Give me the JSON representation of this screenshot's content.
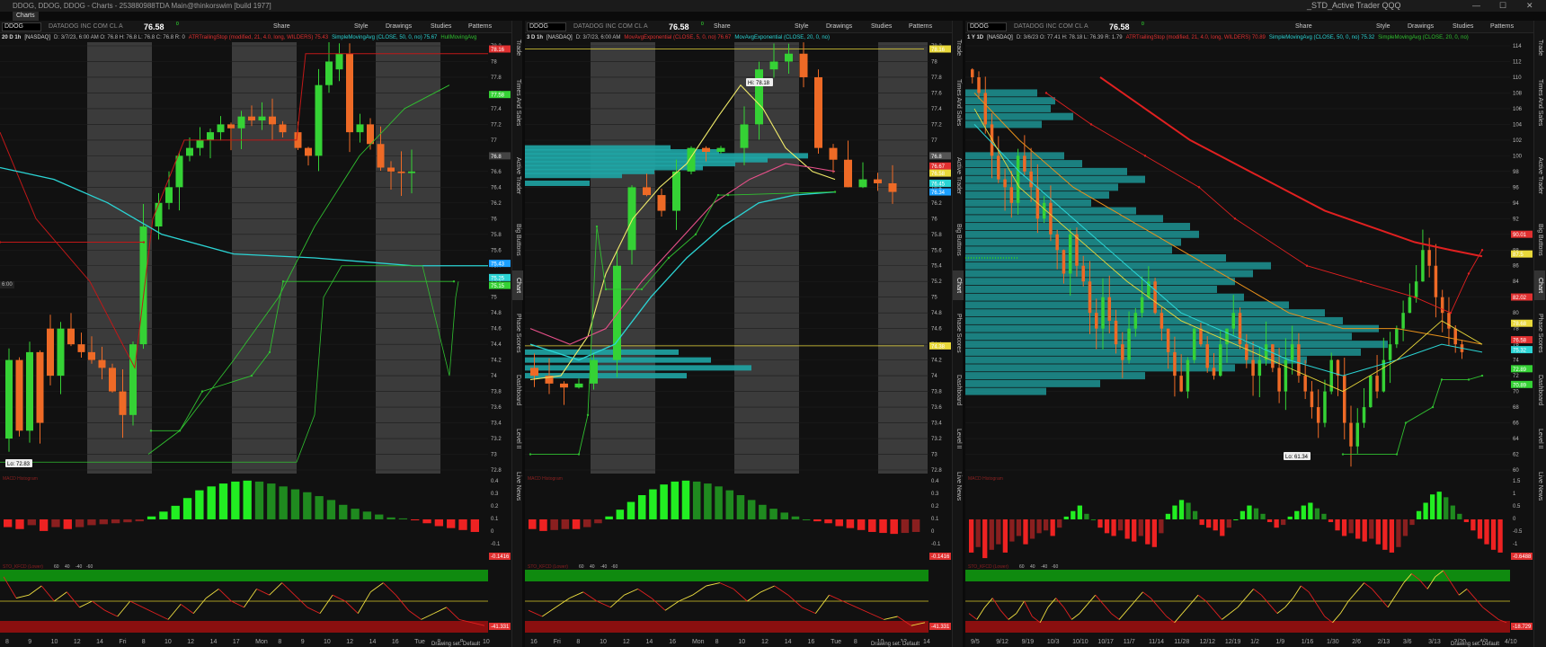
{
  "window": {
    "title": "DDOG, DDOG, DDOG - Charts - 253880988TDA Main@thinkorswim [build 1977]",
    "tab": "Charts",
    "right_title": "_STD_Active Trader QQQ"
  },
  "chart_data": [
    {
      "type": "candlestick",
      "symbol": "DDOG",
      "aggregation": "20 D 1h",
      "exchange": "[NASDAQ]",
      "price": "76.58",
      "ohlc": "D: 3/7/23, 6:00 AM   O: 76.8   H: 76.8   L: 76.8   C: 76.8   R: 0",
      "studies": [
        "ATRTrailingStop (modified, 21, 4.0, long, WILDERS)  75.43",
        "SimpleMovingAvg (CLOSE, 50, 0, no)  75.67",
        "HullMovingAvg"
      ],
      "ylim": [
        72.8,
        78.2
      ],
      "y_ticks": [
        "78.2",
        "78",
        "77.8",
        "77.6",
        "77.4",
        "77.2",
        "77",
        "76.8",
        "76.6",
        "76.4",
        "76.2",
        "76",
        "75.8",
        "75.6",
        "75.4",
        "75.2",
        "75",
        "74.8",
        "74.6",
        "74.4",
        "74.2",
        "74",
        "73.8",
        "73.6",
        "73.4",
        "73.2",
        "73",
        "72.8"
      ],
      "x_labels": [
        "8",
        "9",
        "10",
        "12",
        "14",
        "Fri",
        "8",
        "10",
        "12",
        "14",
        "17",
        "Mon",
        "8",
        "9",
        "10",
        "12",
        "14",
        "16",
        "Tue",
        "8",
        "9",
        "10"
      ],
      "price_tags": [
        "78.16",
        "77.58",
        "76.8",
        "75.43",
        "75.25",
        "75.15"
      ],
      "low_label": "Lo: 72.83",
      "time_flag": "6:00",
      "osc": {
        "name": "MACD Histogram",
        "values": [
          -0.08,
          -0.1,
          -0.06,
          -0.12,
          -0.08,
          -0.1,
          -0.08,
          -0.06,
          -0.05,
          -0.04,
          -0.03,
          -0.02,
          0.03,
          0.08,
          0.14,
          0.22,
          0.3,
          0.34,
          0.37,
          0.39,
          0.4,
          0.39,
          0.37,
          0.34,
          0.31,
          0.28,
          0.24,
          0.2,
          0.15,
          0.11,
          0.08,
          0.05,
          0.02,
          0.01,
          -0.01,
          -0.04,
          -0.07,
          -0.09,
          -0.11,
          -0.13
        ],
        "ticks": [
          "0.4",
          "0.3",
          "0.2",
          "0.1",
          "0",
          "-0.1",
          "-0.1416"
        ]
      },
      "stoch": {
        "name": "STO_KFCD (Lower)",
        "levels": [
          "60",
          "40",
          "-40",
          "-60",
          "-41.331"
        ],
        "values": [
          40,
          5,
          10,
          25,
          0,
          15,
          -10,
          0,
          -15,
          -25,
          0,
          -10,
          -20,
          -30,
          -5,
          -20,
          5,
          20,
          0,
          -10,
          20,
          10,
          30,
          10,
          -10,
          -20,
          10,
          0,
          -20,
          15,
          30,
          10,
          -15,
          -30,
          -20,
          -10,
          -30,
          -35,
          -40
        ]
      }
    },
    {
      "type": "candlestick",
      "symbol": "DDOG",
      "aggregation": "3 D 1h",
      "exchange": "[NASDAQ]",
      "price": "76.58",
      "ohlc": "D: 3/7/23, 6:00 AM",
      "studies": [
        "MovAvgExponential (CLOSE, 5, 0, no)  76.67",
        "MovAvgExponential (CLOSE, 20, 0, no)"
      ],
      "ylim": [
        72.8,
        78.2
      ],
      "y_ticks": [
        "78.2",
        "78",
        "77.8",
        "77.6",
        "77.4",
        "77.2",
        "77",
        "76.8",
        "76.6",
        "76.4",
        "76.2",
        "76",
        "75.8",
        "75.6",
        "75.4",
        "75.2",
        "75",
        "74.8",
        "74.6",
        "74.4",
        "74.2",
        "74",
        "73.8",
        "73.6",
        "73.4",
        "73.2",
        "73",
        "72.8"
      ],
      "x_labels": [
        "16",
        "Fri",
        "8",
        "10",
        "12",
        "14",
        "16",
        "Mon",
        "8",
        "10",
        "12",
        "14",
        "16",
        "Tue",
        "8",
        "10",
        "12",
        "14"
      ],
      "price_tags": [
        "78.16",
        "76.67",
        "76.8",
        "76.58",
        "76.45",
        "76.34",
        "74.38"
      ],
      "high_label": "Hi: 78.18",
      "osc": {
        "name": "MACD Histogram",
        "values": [
          -0.1,
          -0.12,
          -0.11,
          -0.1,
          -0.1,
          -0.08,
          -0.04,
          0.03,
          0.1,
          0.18,
          0.25,
          0.31,
          0.36,
          0.39,
          0.4,
          0.39,
          0.37,
          0.34,
          0.3,
          0.25,
          0.2,
          0.15,
          0.11,
          0.07,
          0.03,
          0.0,
          -0.02,
          -0.04,
          -0.07,
          -0.09,
          -0.11,
          -0.13,
          -0.14,
          -0.15,
          -0.14,
          -0.13
        ],
        "ticks": [
          "0.4",
          "0.3",
          "0.2",
          "0.1",
          "0",
          "-0.1",
          "-0.1416"
        ]
      },
      "stoch": {
        "name": "STO_KFCD (Lower)",
        "levels": [
          "60",
          "40",
          "-40",
          "-60",
          "-41.331"
        ],
        "values": [
          -15,
          -25,
          -10,
          5,
          15,
          0,
          -10,
          10,
          20,
          5,
          -15,
          0,
          10,
          25,
          30,
          20,
          0,
          15,
          25,
          10,
          -10,
          -20,
          10,
          0,
          -10,
          -20,
          -30,
          -25,
          -40,
          -35
        ]
      }
    },
    {
      "type": "candlestick",
      "symbol": "DDOG",
      "aggregation": "1 Y 1D",
      "exchange": "[NASDAQ]",
      "price": "76.58",
      "ohlc": "D: 3/6/23   O: 77.41   H: 78.18   L: 76.39   R: 1.79",
      "studies": [
        "ATRTrailingStop (modified, 21, 4.0, long, WILDERS)  70.89",
        "SimpleMovingAvg (CLOSE, 50, 0, no)  75.32",
        "SimpleMovingAvg (CLOSE, 20, 0, no)"
      ],
      "ylim": [
        60,
        114
      ],
      "y_ticks": [
        "114",
        "112",
        "110",
        "108",
        "106",
        "104",
        "102",
        "100",
        "98",
        "96",
        "94",
        "92",
        "90",
        "88",
        "86",
        "84",
        "82",
        "80",
        "78",
        "76",
        "74",
        "72",
        "70",
        "68",
        "66",
        "64",
        "62",
        "60"
      ],
      "x_labels": [
        "9/5",
        "9/12",
        "9/19",
        "10/3",
        "10/10",
        "10/17",
        "11/7",
        "11/14",
        "11/28",
        "12/12",
        "12/19",
        "1/2",
        "1/9",
        "1/16",
        "1/30",
        "2/6",
        "2/13",
        "3/6",
        "3/13",
        "3/20",
        "4/3",
        "4/10"
      ],
      "price_tags": [
        "90.01",
        "87.5",
        "82.02",
        "78.68",
        "76.58",
        "75.32",
        "72.89",
        "70.89"
      ],
      "low_label": "Lo: 61.34",
      "marker_labels": [
        "$0.23",
        "$0.24"
      ],
      "osc": {
        "name": "MACD Histogram",
        "values": [
          -1.2,
          -1.0,
          -1.4,
          -1.1,
          -0.9,
          -1.2,
          -0.8,
          -0.6,
          -0.9,
          -0.7,
          -0.5,
          -0.4,
          -0.6,
          -0.3,
          0.1,
          0.3,
          0.5,
          0.2,
          0.0,
          -0.3,
          -0.5,
          -0.6,
          -0.4,
          -0.7,
          -0.8,
          -0.6,
          -0.9,
          -1.0,
          -0.5,
          0.2,
          0.5,
          0.7,
          0.6,
          0.3,
          -0.2,
          -0.3,
          -0.4,
          -0.6,
          -0.3,
          0.0,
          0.3,
          0.5,
          0.4,
          0.2,
          -0.1,
          -0.3,
          -0.2,
          0.1,
          0.3,
          0.5,
          0.6,
          0.4,
          0.2,
          -0.1,
          -0.4,
          -0.6,
          -0.5,
          -0.7,
          -0.8,
          -0.7,
          -0.9,
          -1.1,
          -1.2,
          -1.0,
          -0.6,
          -0.2,
          0.3,
          0.6,
          0.9,
          1.0,
          0.8,
          0.5,
          0.2,
          -0.1,
          -0.4,
          -0.7,
          -0.9,
          -1.1,
          -1.2
        ],
        "ticks": [
          "1.5",
          "1",
          "0.5",
          "0",
          "-0.5",
          "-1",
          "-0.6488"
        ]
      },
      "stoch": {
        "name": "STO_KFCD (Lower)",
        "levels": [
          "60",
          "40",
          "-40",
          "-60",
          "-18.729"
        ],
        "values": [
          -20,
          -30,
          -10,
          5,
          -15,
          -30,
          -20,
          0,
          -25,
          -35,
          -10,
          5,
          -10,
          -30,
          -20,
          -5,
          10,
          -5,
          -20,
          -30,
          -15,
          0,
          15,
          5,
          -10,
          -25,
          -35,
          -20,
          -5,
          10,
          0,
          -15,
          -30,
          -20,
          -10,
          5,
          20,
          10,
          -5,
          -20,
          -10,
          5,
          25,
          15,
          -5,
          -25,
          -35,
          -20,
          0,
          15,
          30,
          20,
          5,
          -10,
          10,
          30,
          45,
          35,
          20,
          40,
          50,
          30,
          10,
          20,
          5,
          -10,
          -20,
          -30,
          -35
        ]
      }
    }
  ],
  "side_tabs": [
    "Trade",
    "Times And Sales",
    "Active Trader",
    "Big Buttons",
    "Chart",
    "Phase Scores",
    "Dashboard",
    "Level II",
    "Live News"
  ],
  "toolbar": {
    "share": "Share",
    "style": "Style",
    "drawings": "Drawings",
    "studies": "Studies",
    "patterns": "Patterns"
  },
  "status": {
    "drawing_set": "Drawing set: Default"
  },
  "colors": {
    "bull": "#35d235",
    "bear": "#ee6a26",
    "sma50": "#2bd4d4",
    "trail": "#e02020",
    "hull": "#30c030",
    "vol_profile": "#1fa5a5"
  }
}
